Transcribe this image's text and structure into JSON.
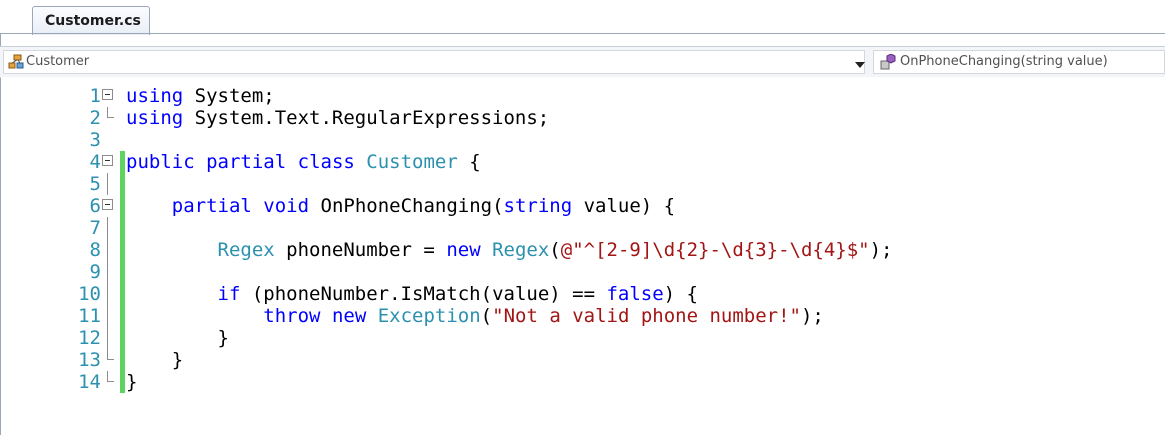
{
  "tab": {
    "title": "Customer.cs"
  },
  "navbar": {
    "type_combo": {
      "value": "Customer",
      "icon": "class-icon"
    },
    "member_combo": {
      "value": "OnPhoneChanging(string value)",
      "icon": "method-icon"
    }
  },
  "editor": {
    "lines": [
      {
        "num": "1",
        "tokens": [
          {
            "t": "using",
            "c": "kw"
          },
          {
            "t": " System;"
          }
        ]
      },
      {
        "num": "2",
        "tokens": [
          {
            "t": "using",
            "c": "kw"
          },
          {
            "t": " System.Text.RegularExpressions;"
          }
        ]
      },
      {
        "num": "3",
        "tokens": []
      },
      {
        "num": "4",
        "tokens": [
          {
            "t": "public",
            "c": "kw"
          },
          {
            "t": " "
          },
          {
            "t": "partial",
            "c": "kw"
          },
          {
            "t": " "
          },
          {
            "t": "class",
            "c": "kw"
          },
          {
            "t": " "
          },
          {
            "t": "Customer",
            "c": "ty"
          },
          {
            "t": " {"
          }
        ]
      },
      {
        "num": "5",
        "tokens": []
      },
      {
        "num": "6",
        "tokens": [
          {
            "t": "    "
          },
          {
            "t": "partial",
            "c": "kw"
          },
          {
            "t": " "
          },
          {
            "t": "void",
            "c": "kw"
          },
          {
            "t": " OnPhoneChanging("
          },
          {
            "t": "string",
            "c": "kw"
          },
          {
            "t": " value) {"
          }
        ]
      },
      {
        "num": "7",
        "tokens": []
      },
      {
        "num": "8",
        "tokens": [
          {
            "t": "        "
          },
          {
            "t": "Regex",
            "c": "ty"
          },
          {
            "t": " phoneNumber = "
          },
          {
            "t": "new",
            "c": "kw"
          },
          {
            "t": " "
          },
          {
            "t": "Regex",
            "c": "ty"
          },
          {
            "t": "("
          },
          {
            "t": "@\"^[2-9]\\d{2}-\\d{3}-\\d{4}$\"",
            "c": "st"
          },
          {
            "t": ");"
          }
        ]
      },
      {
        "num": "9",
        "tokens": []
      },
      {
        "num": "10",
        "tokens": [
          {
            "t": "        "
          },
          {
            "t": "if",
            "c": "kw"
          },
          {
            "t": " (phoneNumber.IsMatch(value) == "
          },
          {
            "t": "false",
            "c": "kw"
          },
          {
            "t": ") {"
          }
        ]
      },
      {
        "num": "11",
        "tokens": [
          {
            "t": "            "
          },
          {
            "t": "throw",
            "c": "kw"
          },
          {
            "t": " "
          },
          {
            "t": "new",
            "c": "kw"
          },
          {
            "t": " "
          },
          {
            "t": "Exception",
            "c": "ty"
          },
          {
            "t": "("
          },
          {
            "t": "\"Not a valid phone number!\"",
            "c": "st"
          },
          {
            "t": ");"
          }
        ]
      },
      {
        "num": "12",
        "tokens": [
          {
            "t": "        }"
          }
        ]
      },
      {
        "num": "13",
        "tokens": [
          {
            "t": "    }"
          }
        ]
      },
      {
        "num": "14",
        "tokens": [
          {
            "t": "}"
          }
        ]
      }
    ]
  }
}
